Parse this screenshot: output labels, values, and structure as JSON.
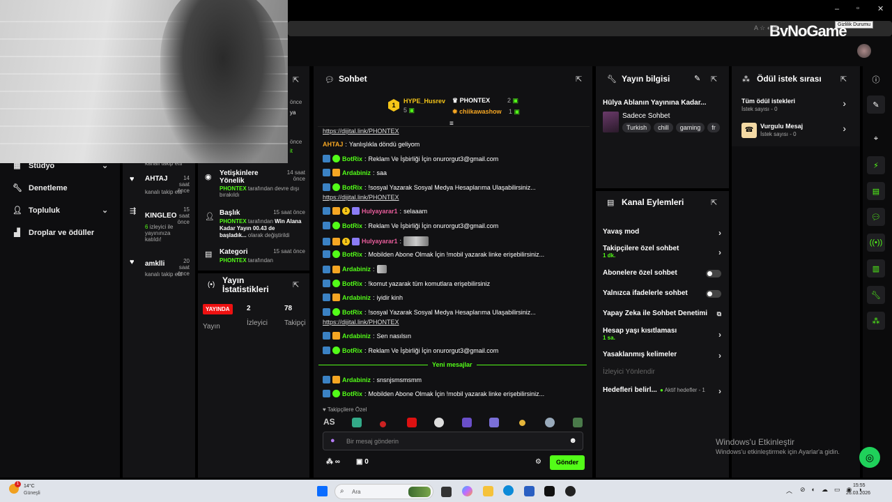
{
  "watermark": "ByNoGame",
  "tooltip": "Gizlilik Durumu",
  "window_controls": {
    "minimize": "–",
    "maximize": "▫",
    "close": "✕"
  },
  "left_nav": [
    {
      "label": "Stüdyo",
      "icon": "studio-icon"
    },
    {
      "label": "Denetleme",
      "icon": "wrench-icon"
    },
    {
      "label": "Topluluk",
      "icon": "people-icon"
    },
    {
      "label": "Droplar ve ödüller",
      "icon": "gift-icon"
    }
  ],
  "feed": {
    "partial_top1": "kanalı takip etti",
    "items": [
      {
        "name": "AHTAJ",
        "time": "14 saat önce",
        "sub": "kanalı takip etti",
        "icon": "heart-icon"
      },
      {
        "name": "KINGLEO",
        "time": "15 saat önce",
        "sub_green": "6",
        "sub": "izleyici ile yayınınıza katıldı!",
        "icon": "raid-icon"
      },
      {
        "name": "amklli",
        "time": "20 saat önce",
        "sub": "kanalı takip etti",
        "icon": "heart-icon"
      }
    ],
    "partial_time1": "önce",
    "partial_time2": "önce",
    "partial_frag1": "ya",
    "partial_frag2": "it"
  },
  "activity": [
    {
      "title": "Yetişkinlere Yönelik",
      "time": "14 saat önce",
      "who": "PHONTEX",
      "text": "tarafından devre dışı bırakıldı"
    },
    {
      "title": "Başlık",
      "time": "15 saat önce",
      "who": "PHONTEX",
      "text": "tarafından",
      "bold": "Win Alana Kadar Yayın 00.43 de başladık...",
      "text2": "olarak değiştirildi"
    },
    {
      "title": "Kategori",
      "time": "15 saat önce",
      "who": "PHONTEX",
      "text": "tarafından"
    }
  ],
  "stats": {
    "title": "Yayın İstatistikleri",
    "live_badge": "YAYINDA",
    "viewers": "2",
    "followers": "78",
    "lbl_stream": "Yayın",
    "lbl_viewers": "İzleyici",
    "lbl_followers": "Takipçi"
  },
  "chat": {
    "title": "Sohbet",
    "leaderboard": [
      {
        "rank": "1",
        "name": "HYPE_Husrev",
        "count": "5"
      },
      {
        "name": "PHONTEX",
        "count": "2"
      },
      {
        "name": "chiikawashow",
        "count": "1"
      }
    ],
    "messages": [
      {
        "link": "https://dijital.link/PHONTEX"
      },
      {
        "user": "AHTAJ",
        "color": "#f5a623",
        "text": "Yanlışlıkla döndü geliyom",
        "badges": []
      },
      {
        "user": "BotRix",
        "color": "#53fc18",
        "text": "Reklam Ve İşbirliği İçin onurorgut3@gmail.com",
        "badges": [
          "b1",
          "b2"
        ]
      },
      {
        "user": "Ardabiniz",
        "color": "#53fc18",
        "text": "saa",
        "badges": [
          "b1",
          "b3"
        ]
      },
      {
        "user": "BotRix",
        "color": "#53fc18",
        "text": "!sosyal Yazarak Sosyal Medya Hesaplarıma Ulaşabilirsiniz...",
        "badges": [
          "b1",
          "b2"
        ]
      },
      {
        "link": "https://dijital.link/PHONTEX"
      },
      {
        "user": "Hulyayarar1",
        "color": "#e85d9b",
        "text": "selaaam",
        "badges": [
          "b1",
          "b3",
          "b4",
          "b5"
        ]
      },
      {
        "user": "BotRix",
        "color": "#53fc18",
        "text": "Reklam Ve İşbirliği İçin onurorgut3@gmail.com",
        "badges": [
          "b1",
          "b2"
        ]
      },
      {
        "user": "Hulyayarar1",
        "color": "#e85d9b",
        "text": "",
        "badges": [
          "b1",
          "b3",
          "b4",
          "b5"
        ]
      },
      {
        "user": "BotRix",
        "color": "#53fc18",
        "text": "Mobilden Abone Olmak İçin !mobil yazarak linke erişebilirsiniz...",
        "badges": [
          "b1",
          "b2"
        ]
      },
      {
        "user": "Ardabiniz",
        "color": "#53fc18",
        "text": "",
        "badges": [
          "b1",
          "b3"
        ]
      },
      {
        "user": "BotRix",
        "color": "#53fc18",
        "text": "!komut yazarak tüm komutlara erişebilirsiniz",
        "badges": [
          "b1",
          "b2"
        ]
      },
      {
        "user": "Ardabiniz",
        "color": "#53fc18",
        "text": "iyidir kinh",
        "badges": [
          "b1",
          "b3"
        ]
      },
      {
        "user": "BotRix",
        "color": "#53fc18",
        "text": "!sosyal Yazarak Sosyal Medya Hesaplarıma Ulaşabilirsiniz...",
        "badges": [
          "b1",
          "b2"
        ]
      },
      {
        "link": "https://dijital.link/PHONTEX"
      },
      {
        "user": "Ardabiniz",
        "color": "#53fc18",
        "text": "Sen nasılsın",
        "badges": [
          "b1",
          "b3"
        ]
      },
      {
        "user": "BotRix",
        "color": "#53fc18",
        "text": "Reklam Ve İşbirliği İçin onurorgut3@gmail.com",
        "badges": [
          "b1",
          "b2"
        ]
      },
      {
        "divider": "Yeni mesajlar"
      },
      {
        "user": "Ardabiniz",
        "color": "#53fc18",
        "text": "snsnjsmsmsmm",
        "badges": [
          "b1",
          "b3"
        ]
      },
      {
        "user": "BotRix",
        "color": "#53fc18",
        "text": "Mobilden Abone Olmak İçin !mobil yazarak linke erişebilirsiniz...",
        "badges": [
          "b1",
          "b2"
        ]
      }
    ],
    "followers_only": "Takipçilere Özel",
    "input_placeholder": "Bir mesaj gönderin",
    "points": "∞",
    "drops": "0",
    "send": "Gönder"
  },
  "stream_info": {
    "title": "Yayın bilgisi",
    "stream_title": "Hülya Ablanın Yayınına Kadar...",
    "category": "Sadece Sohbet",
    "tags": [
      "Turkish",
      "chill",
      "gaming",
      "fr"
    ]
  },
  "rewards": {
    "title": "Ödül istek sırası",
    "items": [
      {
        "name": "Tüm ödül istekleri",
        "sub": "İstek sayısı - 0"
      },
      {
        "name": "Vurgulu Mesaj",
        "sub": "İstek sayısı - 0"
      }
    ]
  },
  "channel_actions": {
    "title": "Kanal Eylemleri",
    "rows": [
      {
        "label": "Yavaş mod",
        "type": "chev"
      },
      {
        "label": "Takipçilere özel sohbet",
        "sub": "1 dk.",
        "type": "chev"
      },
      {
        "label": "Abonelere özel sohbet",
        "type": "toggle"
      },
      {
        "label": "Yalnızca ifadelerle sohbet",
        "type": "toggle"
      },
      {
        "label": "Yapay Zeka ile Sohbet Denetimi",
        "type": "ext"
      },
      {
        "label": "Hesap yaşı kısıtlaması",
        "sub": "1 sa.",
        "type": "chev"
      },
      {
        "label": "Yasaklanmış kelimeler",
        "type": "chev"
      },
      {
        "label": "İzleyici Yönlendir",
        "type": "disabled"
      },
      {
        "label": "Hedefleri belirl...",
        "extra": "Aktif hedefler - 1",
        "type": "chev"
      }
    ]
  },
  "activation": {
    "line1": "Windows'u Etkinleştir",
    "line2": "Windows'u etkinleştirmek için Ayarlar'a gidin."
  },
  "taskbar": {
    "weather_temp": "14°C",
    "weather_text": "Güneşli",
    "search": "Ara",
    "time": "15:55",
    "date": "26.03.2026",
    "notif_badge": "1"
  }
}
